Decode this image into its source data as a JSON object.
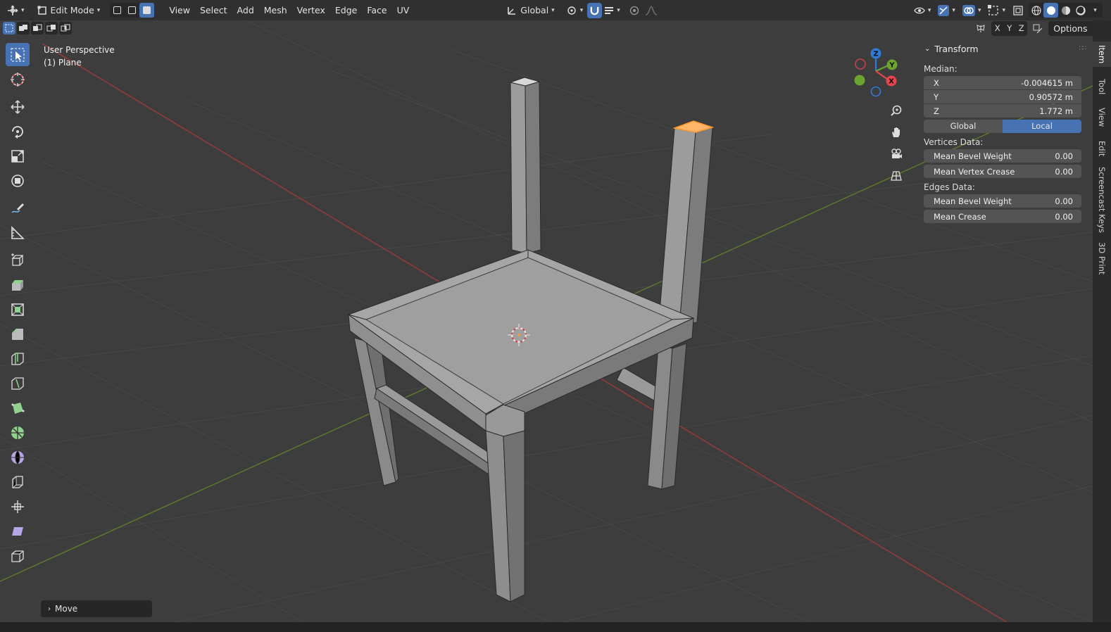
{
  "header": {
    "editor_type_icon": "move-gizmo-icon",
    "mode_label": "Edit Mode",
    "menu": [
      "View",
      "Select",
      "Add",
      "Mesh",
      "Vertex",
      "Edge",
      "Face",
      "UV"
    ],
    "transform_orientation": "Global"
  },
  "toolbar_row2": {
    "axis_labels": [
      "X",
      "Y",
      "Z"
    ],
    "options_label": "Options"
  },
  "viewport": {
    "view_name": "User Perspective",
    "object_name": "(1) Plane"
  },
  "gizmo": {
    "x_label": "X",
    "y_label": "Y",
    "z_label": "Z",
    "colors": {
      "x": "#e7444f",
      "y": "#6ba42f",
      "z": "#2f7ad8"
    }
  },
  "npanel": {
    "section_title": "Transform",
    "median_label": "Median:",
    "median": [
      {
        "axis": "X",
        "value": "-0.004615 m"
      },
      {
        "axis": "Y",
        "value": "0.90572 m"
      },
      {
        "axis": "Z",
        "value": "1.772 m"
      }
    ],
    "space_global": "Global",
    "space_local": "Local",
    "vertices_label": "Vertices Data:",
    "vertices": [
      {
        "label": "Mean Bevel Weight",
        "value": "0.00"
      },
      {
        "label": "Mean Vertex Crease",
        "value": "0.00"
      }
    ],
    "edges_label": "Edges Data:",
    "edges": [
      {
        "label": "Mean Bevel Weight",
        "value": "0.00"
      },
      {
        "label": "Mean Crease",
        "value": "0.00"
      }
    ]
  },
  "tabs": [
    "Item",
    "Tool",
    "View",
    "Edit",
    "Screencast Keys",
    "3D Print"
  ],
  "last_operator": "Move",
  "colors": {
    "accent": "#4772b3",
    "selected": "#ff9a2e",
    "grid_x_axis": "#9b3a3a",
    "grid_y_axis": "#5d7d2a"
  }
}
